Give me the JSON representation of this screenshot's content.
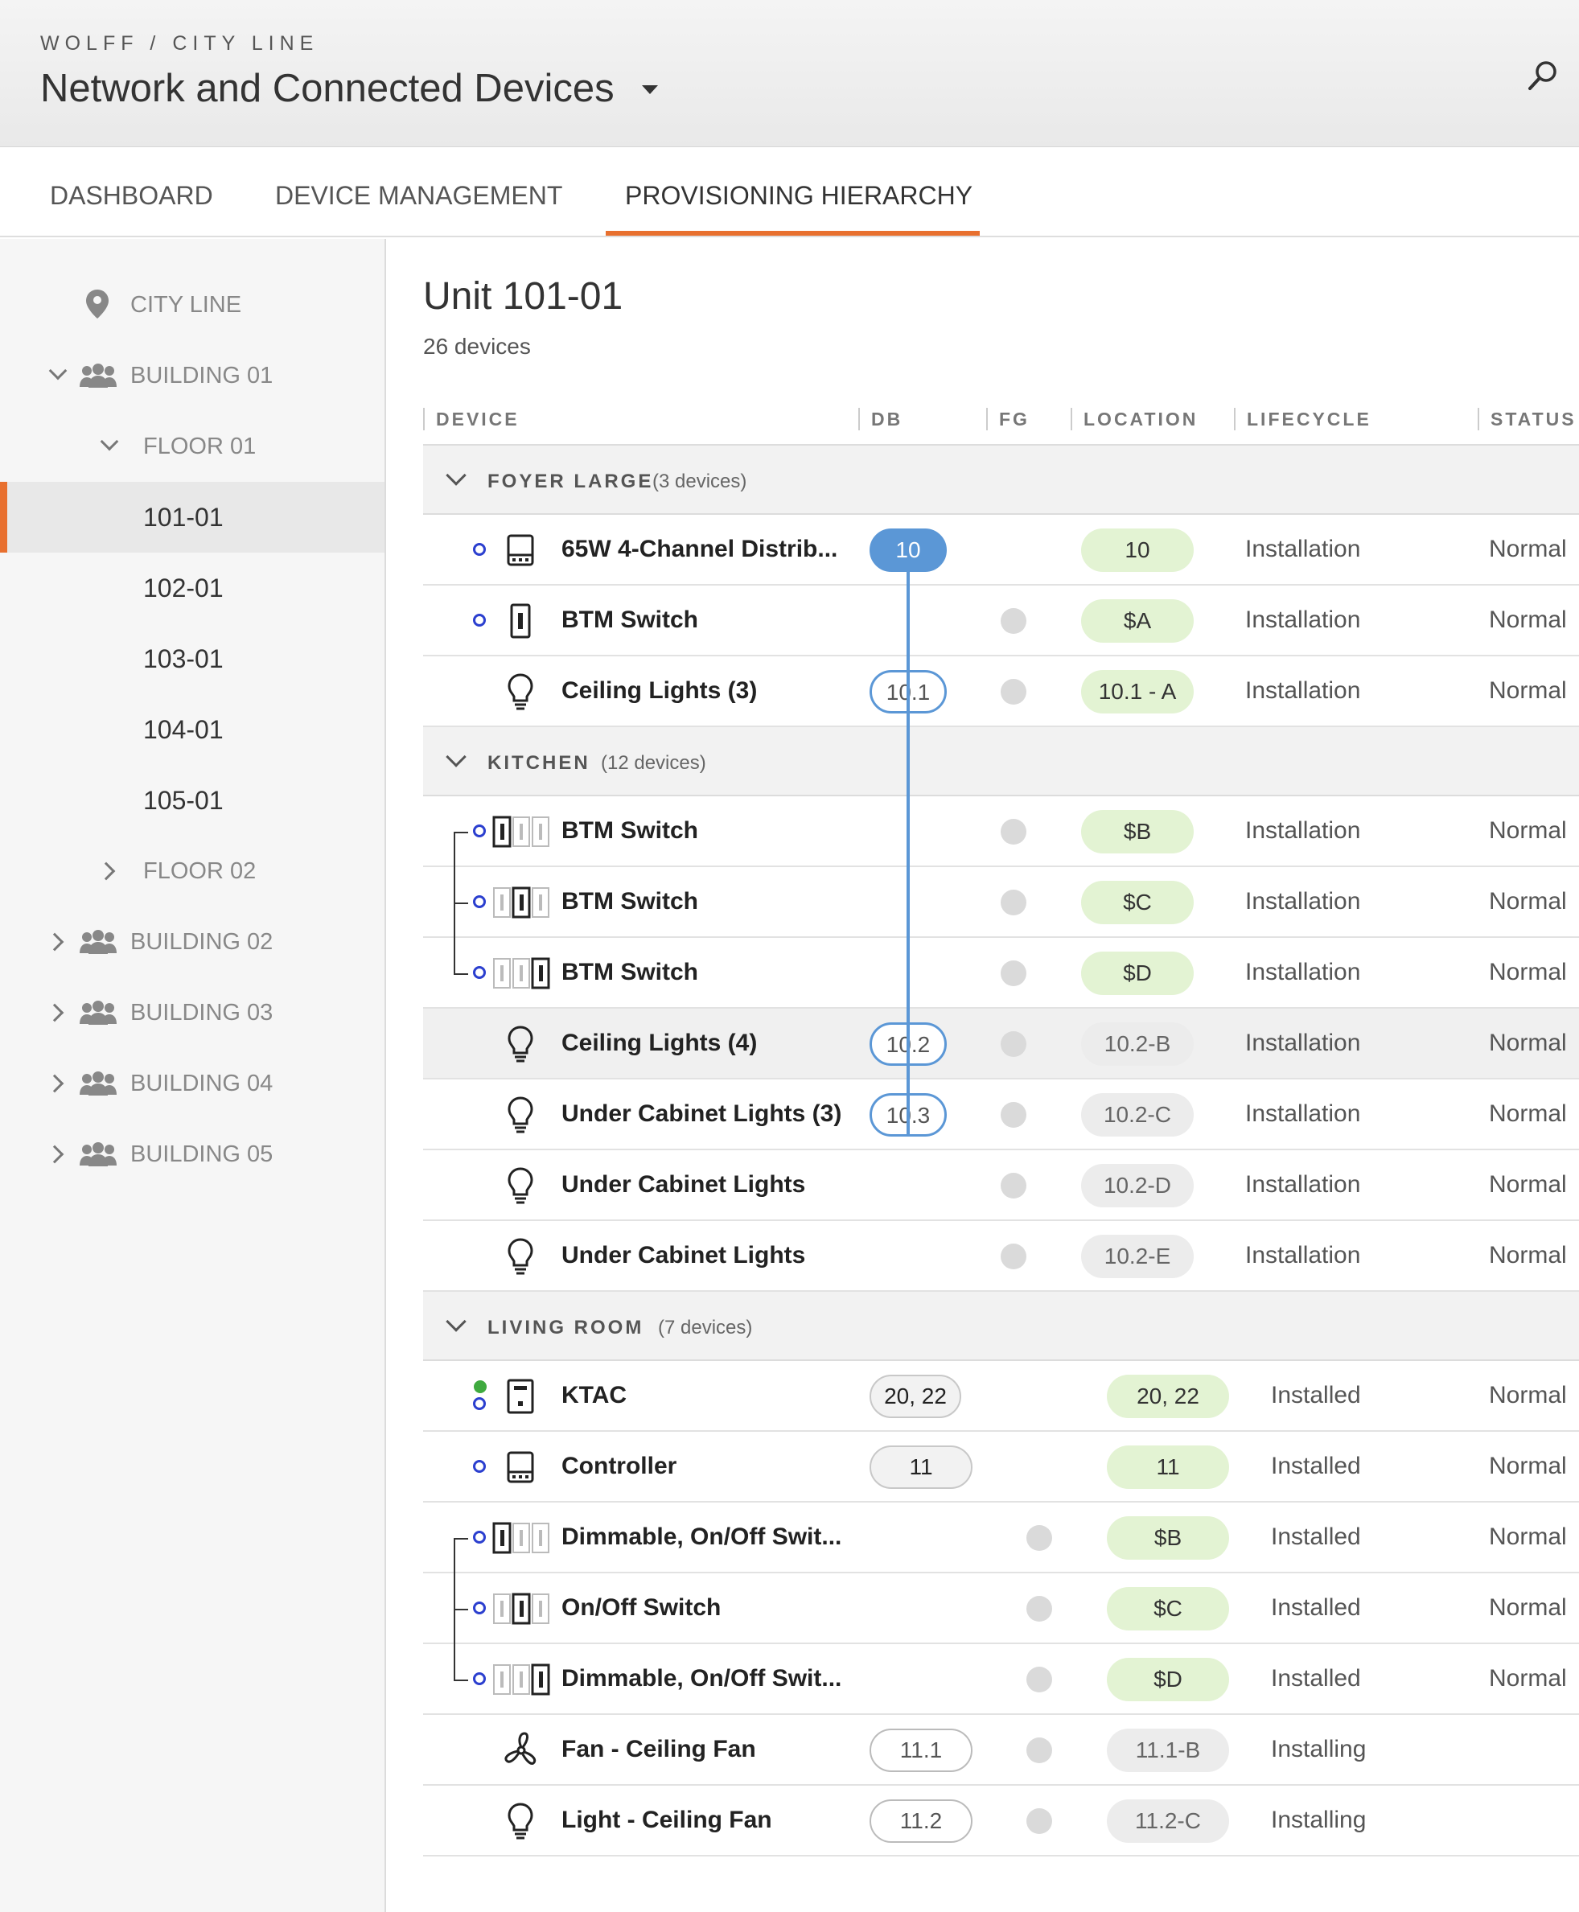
{
  "header": {
    "breadcrumb": "WOLFF / CITY LINE",
    "title": "Network and Connected Devices"
  },
  "tabs": [
    {
      "label": "DASHBOARD"
    },
    {
      "label": "DEVICE MANAGEMENT"
    },
    {
      "label": "PROVISIONING HIERARCHY",
      "active": true
    }
  ],
  "sidebar": {
    "city": "CITY LINE",
    "building_01": "BUILDING 01",
    "floor_01": "FLOOR 01",
    "units": [
      "101-01",
      "102-01",
      "103-01",
      "104-01",
      "105-01"
    ],
    "floor_02": "FLOOR 02",
    "buildings": [
      "BUILDING 02",
      "BUILDING 03",
      "BUILDING 04",
      "BUILDING 05"
    ]
  },
  "main": {
    "title": "Unit 101-01",
    "count": "26 devices",
    "columns": [
      "DEVICE",
      "DB",
      "FG",
      "LOCATION",
      "LIFECYCLE",
      "STATUS"
    ],
    "groups": [
      {
        "name": "FOYER LARGE",
        "count": "(3 devices)"
      },
      {
        "name": "KITCHEN",
        "count": "(12 devices)"
      },
      {
        "name": "LIVING ROOM",
        "count": "(7 devices)"
      }
    ],
    "rows": [
      {
        "name": "65W 4-Channel Distrib...",
        "icon": "distributor-icon",
        "db": "10",
        "location": "10",
        "lifecycle": "Installation",
        "status": "Normal"
      },
      {
        "name": "BTM Switch",
        "icon": "switch-icon",
        "location": "$A",
        "lifecycle": "Installation",
        "status": "Normal"
      },
      {
        "name": "Ceiling Lights (3)",
        "icon": "lightbulb-icon",
        "db": "10.1",
        "location": "10.1 - A",
        "lifecycle": "Installation",
        "status": "Normal"
      },
      {
        "name": "BTM Switch",
        "icon": "switch-gang-icon",
        "location": "$B",
        "lifecycle": "Installation",
        "status": "Normal"
      },
      {
        "name": "BTM Switch",
        "icon": "switch-gang-icon",
        "location": "$C",
        "lifecycle": "Installation",
        "status": "Normal"
      },
      {
        "name": "BTM Switch",
        "icon": "switch-gang-icon",
        "location": "$D",
        "lifecycle": "Installation",
        "status": "Normal"
      },
      {
        "name": "Ceiling Lights (4)",
        "icon": "lightbulb-icon",
        "db": "10.2",
        "location": "10.2-B",
        "lifecycle": "Installation",
        "status": "Normal"
      },
      {
        "name": "Under Cabinet Lights (3)",
        "icon": "lightbulb-icon",
        "db": "10.3",
        "location": "10.2-C",
        "lifecycle": "Installation",
        "status": "Normal"
      },
      {
        "name": "Under Cabinet Lights",
        "icon": "lightbulb-icon",
        "location": "10.2-D",
        "lifecycle": "Installation",
        "status": "Normal"
      },
      {
        "name": "Under Cabinet Lights",
        "icon": "lightbulb-icon",
        "location": "10.2-E",
        "lifecycle": "Installation",
        "status": "Normal"
      },
      {
        "name": "KTAC",
        "icon": "thermostat-icon",
        "db": "20, 22",
        "location": "20, 22",
        "lifecycle": "Installed",
        "status": "Normal"
      },
      {
        "name": "Controller",
        "icon": "controller-icon",
        "db": "11",
        "location": "11",
        "lifecycle": "Installed",
        "status": "Normal"
      },
      {
        "name": "Dimmable, On/Off Swit...",
        "icon": "switch-gang-icon",
        "location": "$B",
        "lifecycle": "Installed",
        "status": "Normal"
      },
      {
        "name": "On/Off Switch",
        "icon": "switch-gang-icon",
        "location": "$C",
        "lifecycle": "Installed",
        "status": "Normal"
      },
      {
        "name": "Dimmable, On/Off Swit...",
        "icon": "switch-gang-icon",
        "location": "$D",
        "lifecycle": "Installed",
        "status": "Normal"
      },
      {
        "name": "Fan - Ceiling Fan",
        "icon": "fan-icon",
        "db": "11.1",
        "location": "11.1-B",
        "lifecycle": "Installing",
        "status": ""
      },
      {
        "name": "Light - Ceiling Fan",
        "icon": "lightbulb-icon",
        "db": "11.2",
        "location": "11.2-C",
        "lifecycle": "Installing",
        "status": ""
      }
    ]
  },
  "colors": {
    "accent": "#e8702f",
    "db_link": "#5b97d6",
    "location_green": "#e3f3d3",
    "ring": "#2b3fcf",
    "online": "#3faa3f"
  }
}
